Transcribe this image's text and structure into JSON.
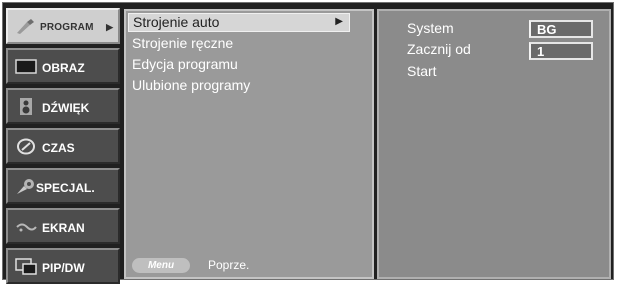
{
  "categories": [
    {
      "label": "PROGRAM",
      "icon": "program-icon",
      "selected": true,
      "arrow": "▶"
    },
    {
      "label": "OBRAZ",
      "icon": "picture-icon"
    },
    {
      "label": "DŹWIĘK",
      "icon": "speaker-icon"
    },
    {
      "label": "CZAS",
      "icon": "clock-icon"
    },
    {
      "label": "SPECJAL.",
      "icon": "special-icon"
    },
    {
      "label": "EKRAN",
      "icon": "screen-icon"
    },
    {
      "label": "PIP/DW",
      "icon": "pip-icon"
    }
  ],
  "submenu": {
    "items": [
      {
        "label": "Strojenie auto",
        "arrow": "▶"
      },
      {
        "label": "Strojenie ręczne"
      },
      {
        "label": "Edycja programu"
      },
      {
        "label": "Ulubione programy"
      }
    ],
    "menu_button": "Menu",
    "previous_label": "Poprze."
  },
  "settings": [
    {
      "label": "System",
      "value": "BG"
    },
    {
      "label": "Zacznij  od",
      "value": "1"
    },
    {
      "label": "Start"
    }
  ]
}
